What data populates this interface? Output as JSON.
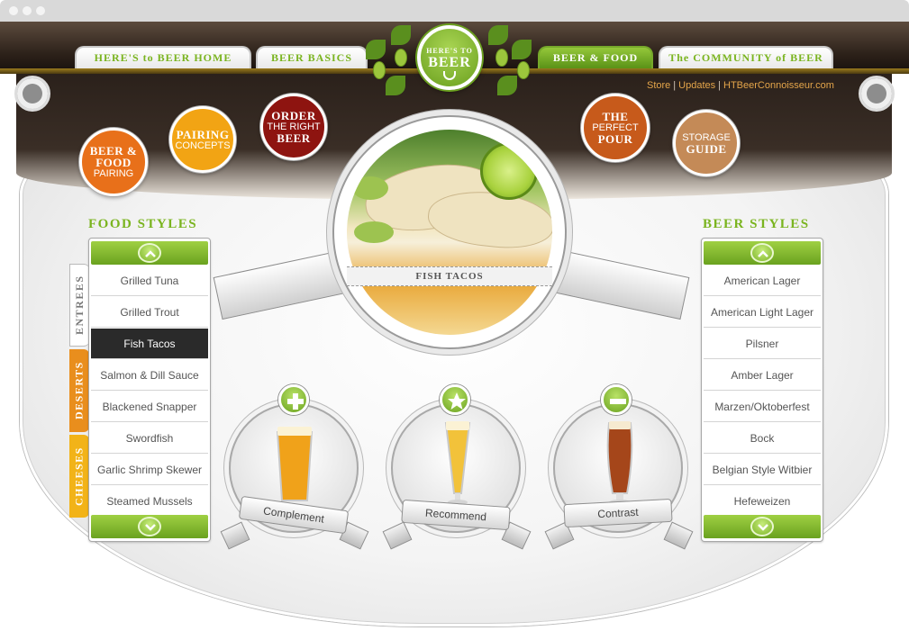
{
  "nav_tabs": {
    "home": "HERE'S to BEER HOME",
    "basics": "BEER BASICS",
    "food": "BEER & FOOD",
    "community": "The COMMUNITY of BEER"
  },
  "logo": {
    "line1": "HERE'S TO",
    "line2": "BEER"
  },
  "utility_links": [
    "Store",
    "Updates",
    "HTBeerConnoisseur.com"
  ],
  "utility_separator": "|",
  "sections": {
    "beer_food_pairing": {
      "line1": "BEER &",
      "line2": "FOOD",
      "line3": "PAIRING",
      "color": "#e8701a"
    },
    "pairing_concepts": {
      "line1": "PAIRING",
      "line2": "CONCEPTS",
      "color": "#f2a414"
    },
    "order_right_beer": {
      "line1": "ORDER",
      "line2": "THE RIGHT",
      "line3": "BEER",
      "color": "#8e1410"
    },
    "perfect_pour": {
      "line1": "THE",
      "line2": "PERFECT",
      "line3": "POUR",
      "color": "#c75a1b"
    },
    "storage_guide": {
      "line1": "STORAGE",
      "line2": "GUIDE",
      "color": "#c48a57"
    }
  },
  "featured_dish": "FISH TACOS",
  "food_styles": {
    "title": "FOOD STYLES",
    "tabs": [
      "ENTREES",
      "DESERTS",
      "CHEESES"
    ],
    "active_tab": "ENTREES",
    "items": [
      "Grilled Tuna",
      "Grilled Trout",
      "Fish Tacos",
      "Salmon & Dill Sauce",
      "Blackened Snapper",
      "Swordfish",
      "Garlic Shrimp Skewer",
      "Steamed Mussels"
    ],
    "selected": "Fish Tacos"
  },
  "beer_styles": {
    "title": "BEER STYLES",
    "items": [
      "American Lager",
      "American Light Lager",
      "Pilsner",
      "Amber Lager",
      "Marzen/Oktoberfest",
      "Bock",
      "Belgian Style Witbier",
      "Hefeweizen"
    ]
  },
  "pairings": [
    {
      "label": "Complement",
      "icon": "plus-icon",
      "beer_color": "#f0a21a"
    },
    {
      "label": "Recommend",
      "icon": "star-icon",
      "beer_color": "#f2c23a"
    },
    {
      "label": "Contrast",
      "icon": "minus-icon",
      "beer_color": "#a5461a"
    }
  ],
  "colors": {
    "accent_green": "#7ab41f",
    "header_dark": "#2c2119",
    "link_orange": "#e4a54a"
  }
}
